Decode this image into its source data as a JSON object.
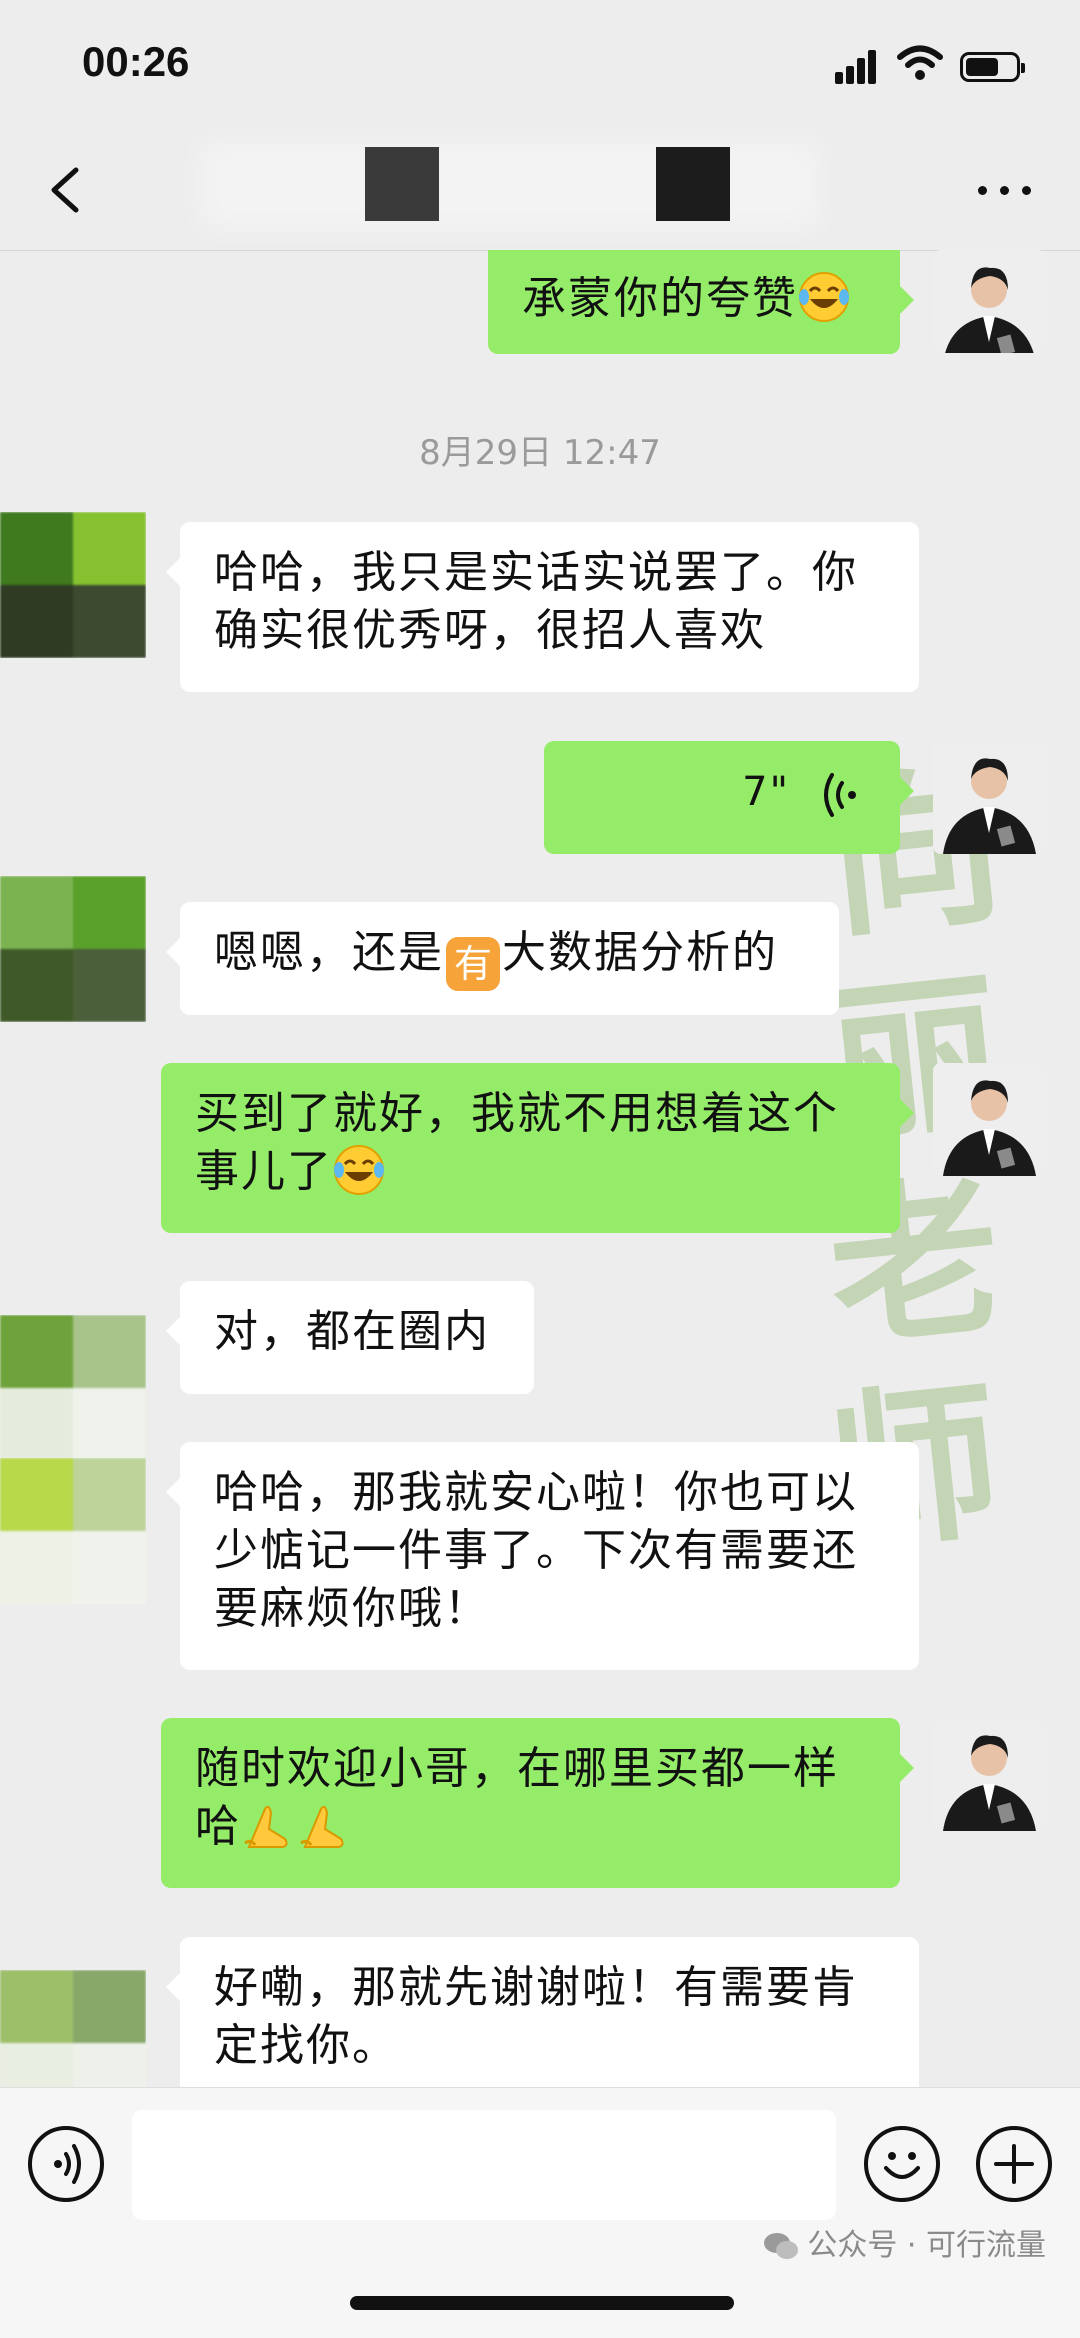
{
  "status_bar": {
    "time": "00:26"
  },
  "nav": {
    "back_icon": "chevron-left-icon",
    "more_icon": "more-dots-icon"
  },
  "messages": {
    "m1": {
      "text": "承蒙你的夸赞"
    },
    "timestamp": "8月29日 12:47",
    "m2": {
      "text": "哈哈，我只是实话实说罢了。你确实很优秀呀，很招人喜欢"
    },
    "m3": {
      "duration": "7\""
    },
    "m4": {
      "text_before": "嗯嗯，还是",
      "badge": "有",
      "text_after": "大数据分析的"
    },
    "m5": {
      "text": "买到了就好，我就不用想着这个事儿了"
    },
    "m6": {
      "text": "对，都在圈内"
    },
    "m7": {
      "text": "哈哈，那我就安心啦！你也可以少惦记一件事了。下次有需要还要麻烦你哦！"
    },
    "m8": {
      "text": "随时欢迎小哥，在哪里买都一样哈"
    },
    "m9": {
      "text": "好嘞，那就先谢谢啦！有需要肯定找你。"
    }
  },
  "watermark": {
    "chars": [
      "向",
      "丽",
      "老",
      "师"
    ]
  },
  "input_bar": {
    "placeholder": ""
  },
  "footer": {
    "credit": "公众号 · 可行流量"
  },
  "colors": {
    "self_bubble": "#95ec69",
    "peer_bubble": "#ffffff",
    "background": "#ededed"
  }
}
